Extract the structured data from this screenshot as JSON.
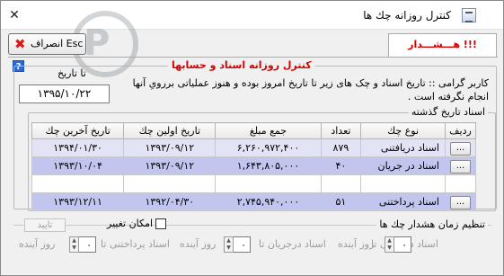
{
  "window": {
    "title": "کنترل روزانه چك ها",
    "close_glyph": "✕"
  },
  "toolbar": {
    "cancel_label": "انصراف Esc",
    "help_glyph": "?"
  },
  "tabs": [
    {
      "label": "هـــشـــدار !!!",
      "selected": true,
      "color": "#d40000"
    }
  ],
  "main_group": {
    "legend": "کنترل روزانه اسناد و حسابها",
    "date_label": "تا تاريخ",
    "date_value": "۱۳۹۵/۱۰/۲۲",
    "message": "کاربر گرامی :: تاريخ اسناد و چک های زير تا تاريخ امروز بوده و هنوز عملياتی بررویِ آنها انجام نگرفته است ."
  },
  "docs_group": {
    "legend": "اسناد تاريخ گذشته",
    "columns": [
      "رديف",
      "نوع چك",
      "تعداد",
      "جمع مبلغ",
      "تاريخ اولين چك",
      "تاريخ آخرين چك"
    ],
    "rows": [
      {
        "btn": "...",
        "type": "اسناد دريافتنی",
        "count": "۸۷۹",
        "sum": "۶,۲۶۰,۹۷۲,۴۰۰",
        "first": "۱۳۹۳/۰۹/۱۲",
        "last": "۱۳۹۴/۰۱/۳۰",
        "style": "row-a"
      },
      {
        "btn": "...",
        "type": "اسناد در جريان",
        "count": "۴۰",
        "sum": "۱,۶۴۳,۸۰۵,۰۰۰",
        "first": "۱۳۹۳/۰۹/۱۲",
        "last": "۱۳۹۳/۱۰/۰۴",
        "style": "row-b"
      },
      {
        "btn": "",
        "type": "",
        "count": "",
        "sum": "",
        "first": "",
        "last": "",
        "style": "row-c"
      },
      {
        "btn": "...",
        "type": "اسناد پرداختنی",
        "count": "۵۱",
        "sum": "۲,۷۴۵,۹۴۰,۰۰۰",
        "first": "۱۳۹۲/۰۴/۳۰",
        "last": "۱۳۹۳/۱۲/۱۱",
        "style": "row-b"
      }
    ]
  },
  "settings": {
    "legend": "تنظيم زمان هشدار چك ها",
    "allow_change_label": "امكان تغيير",
    "confirm_label": "تاييد",
    "received_label": "اسناد دريافتنی تا",
    "received_value": "۰",
    "inprogress_label": "اسناد درجريان تا",
    "inprogress_value": "۰",
    "payable_label": "اسناد پرداختنی تا",
    "payable_value": "۰",
    "days_suffix": "روز آينده"
  }
}
